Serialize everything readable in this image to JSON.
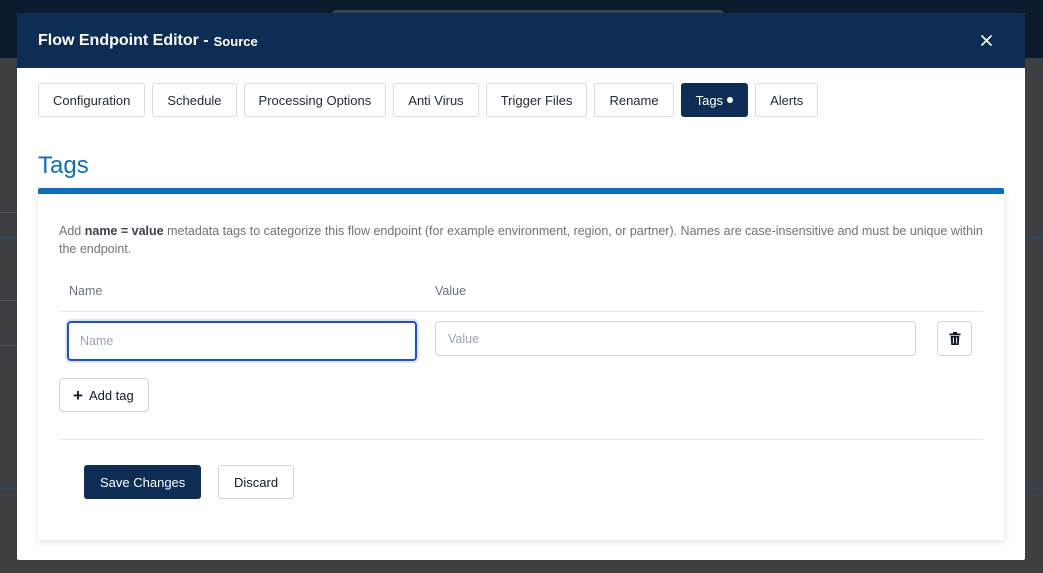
{
  "modal": {
    "title": "Flow Endpoint Editor -",
    "subtitle": "Source",
    "close_icon": "close-icon"
  },
  "tabs": [
    {
      "label": "Configuration",
      "active": false
    },
    {
      "label": "Schedule",
      "active": false
    },
    {
      "label": "Processing Options",
      "active": false
    },
    {
      "label": "Anti Virus",
      "active": false
    },
    {
      "label": "Trigger Files",
      "active": false
    },
    {
      "label": "Rename",
      "active": false
    },
    {
      "label": "Tags",
      "active": true,
      "has_dot": true
    },
    {
      "label": "Alerts",
      "active": false
    }
  ],
  "section": {
    "title": "Tags",
    "desc_prefix": "Add",
    "desc_bold": "name = value",
    "desc_rest": "metadata tags to categorize this flow endpoint (for example environment, region, or partner). Names are case-insensitive and must be unique within the endpoint."
  },
  "table": {
    "name_header": "Name",
    "value_header": "Value",
    "rows": [
      {
        "name": "",
        "value": "",
        "name_placeholder": "Name",
        "value_placeholder": "Value"
      }
    ],
    "delete_icon": "trash-icon"
  },
  "actions": {
    "add_tag": "Add tag",
    "save": "Save Changes",
    "discard": "Discard"
  },
  "colors": {
    "header_bg": "#0e2d55",
    "accent": "#0a6fc2",
    "focus": "#1d4ed8"
  }
}
